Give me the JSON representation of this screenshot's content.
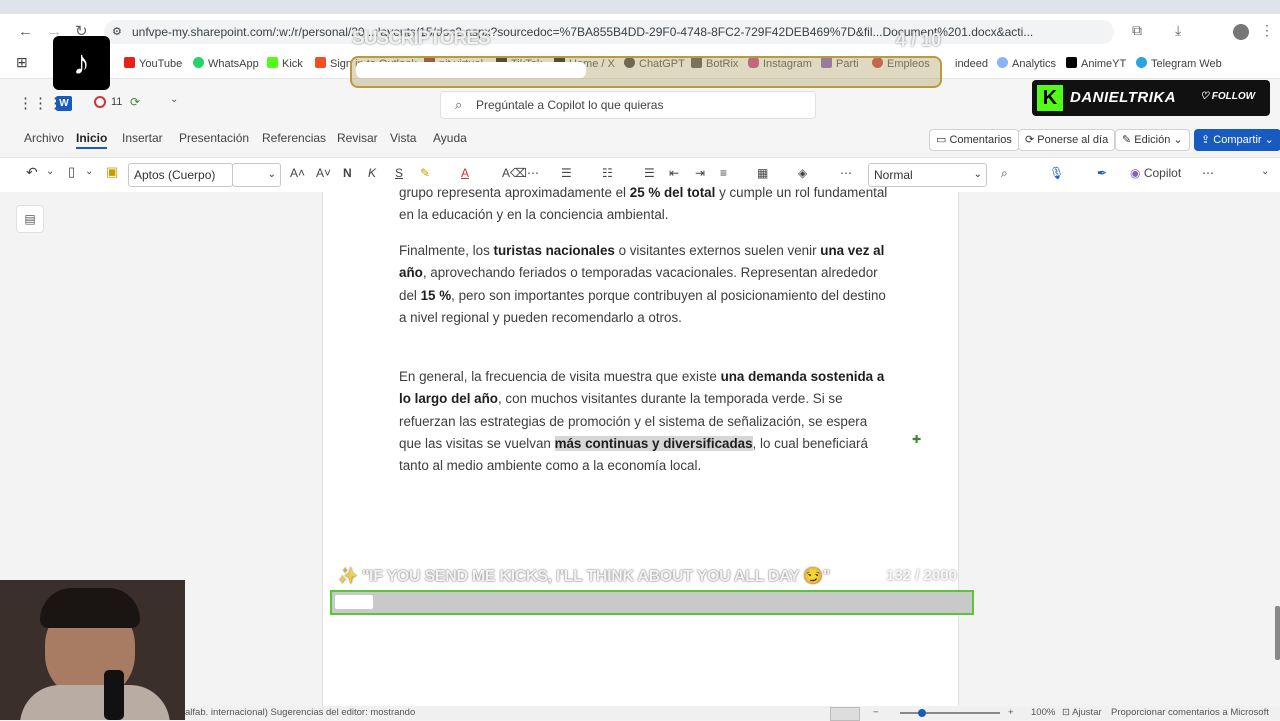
{
  "browser": {
    "url": "unfvpe-my.sharepoint.com/:w:/r/personal/20...:layouts/15/doc2.aspx?sourcedoc=%7BA855B4DD-29F0-4748-8FC2-729F42DEB469%7D&fil...Document%201.docx&acti...",
    "bookmarks": [
      "YouTube",
      "WhatsApp",
      "Kick",
      "Sign in to Outlook",
      "pit virtual",
      "TikTok",
      "Home / X",
      "ChatGPT",
      "BotRix",
      "Instagram",
      "Parti",
      "Empleos",
      "indeed",
      "Analytics",
      "AnimeYT",
      "Telegram Web"
    ]
  },
  "office": {
    "notif_count": "11",
    "search_placeholder": "Pregúntale a Copilot lo que quieras",
    "menu": [
      "Archivo",
      "Inicio",
      "Insertar",
      "Presentación",
      "Referencias",
      "Revisar",
      "Vista",
      "Ayuda"
    ],
    "comments_label": "Comentarios",
    "catchup_label": "Ponerse al día",
    "edit_label": "Edición",
    "share_label": "Compartir"
  },
  "ribbon": {
    "font_name": "Aptos (Cuerpo)",
    "style_name": "Normal",
    "copilot_label": "Copilot"
  },
  "document": {
    "p1a": "grupo representa aproximadamente el ",
    "p1b": "25 % del total",
    "p1c": " y cumple un rol fundamental en la educación y en la conciencia ambiental.",
    "p2a": "Finalmente, los ",
    "p2b": "turistas nacionales",
    "p2c": " o visitantes externos suelen venir ",
    "p2d": "una vez al año",
    "p2e": ", aprovechando feriados o temporadas vacacionales. Representan alrededor del ",
    "p2f": "15 %",
    "p2g": ", pero son importantes porque contribuyen al posicionamiento del destino a nivel regional y pueden recomendarlo a otros.",
    "p3a": "En general, la frecuencia de visita muestra que existe ",
    "p3b": "una demanda sostenida a lo largo del año",
    "p3c": ", con muchos visitantes durante la temporada verde. Si se refuerzan las estrategias de promoción y  el sistema de señalización, se espera que las visitas se vuelvan ",
    "p3d": "más continuas y diversificadas",
    "p3e": ", lo cual beneficiará tanto al medio ambiente como a la economía local."
  },
  "stream": {
    "subs_label": "SUSCRIPTORES",
    "subs_count": "4 / 10",
    "kick_name": "DANIELTRIKA",
    "follow_label": "FOLLOW",
    "goal_text": "✨ \"IF YOU SEND ME KICKS, I'LL THINK ABOUT YOU ALL DAY 😏\"",
    "goal_count": "132  / 2000",
    "goal_progress": 0.066
  },
  "statusbar": {
    "left": "alfab. internacional)   Sugerencias del editor: mostrando",
    "zoom": "100%",
    "fit": "Ajustar",
    "feedback": "Proporcionar comentarios a Microsoft"
  },
  "colors": {
    "accent": "#185abd",
    "kick_green": "#53fc18"
  }
}
